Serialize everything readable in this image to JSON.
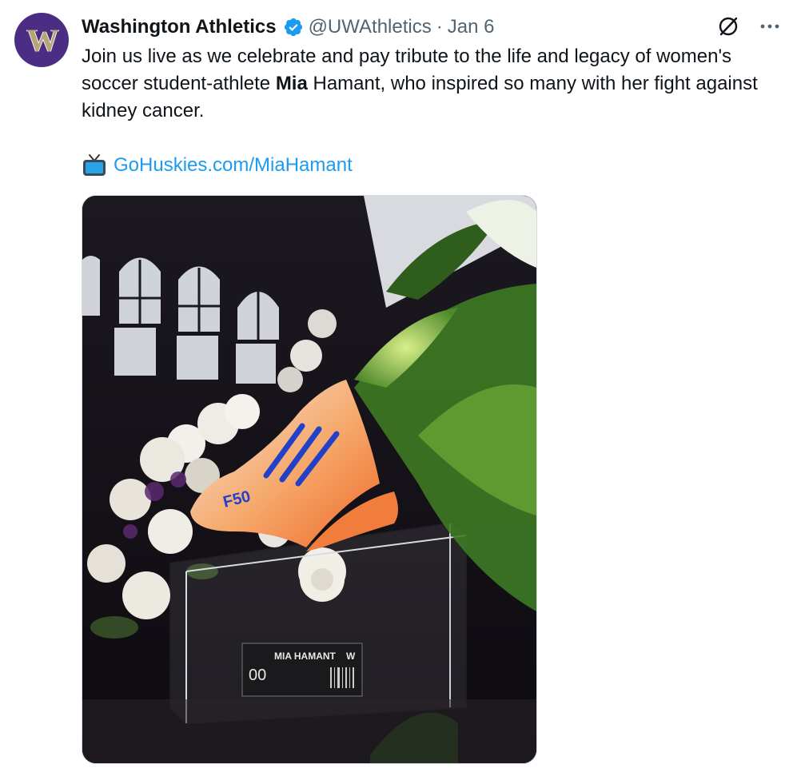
{
  "author": {
    "display_name": "Washington Athletics",
    "handle": "@UWAthletics",
    "separator": "·",
    "date": "Jan 6",
    "avatar_letter": "W",
    "verified": true
  },
  "tweet": {
    "text_part1": "Join us live as we celebrate and pay tribute to the life and legacy of women's soccer student-athlete ",
    "text_bold": "Mia",
    "text_part2": " Hamant, who inspired so many with her fight against kidney cancer.",
    "link_text": "GoHuskies.com/MiaHamant"
  },
  "media": {
    "cleat_label": "F50",
    "plaque_name": "MIA HAMANT",
    "plaque_letter": "W",
    "plaque_number": "00"
  },
  "colors": {
    "brand_purple": "#4b2e83",
    "link_blue": "#1d9bf0",
    "verified_blue": "#1d9bf0",
    "secondary_text": "#536471"
  },
  "icons": [
    "verified-badge-icon",
    "grok-icon",
    "more-icon",
    "tv-icon"
  ]
}
